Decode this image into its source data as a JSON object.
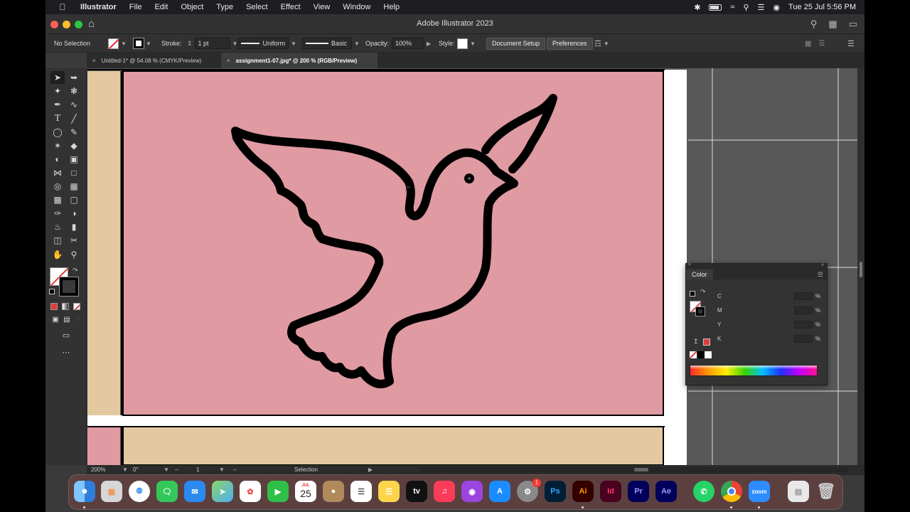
{
  "menubar": {
    "app_name": "Illustrator",
    "items": [
      "File",
      "Edit",
      "Object",
      "Type",
      "Select",
      "Effect",
      "View",
      "Window",
      "Help"
    ],
    "datetime": "Tue 25 Jul  5:56 PM"
  },
  "window": {
    "title": "Adobe Illustrator 2023"
  },
  "controlbar": {
    "selection_label": "No Selection",
    "stroke_label": "Stroke:",
    "stroke_weight": "1 pt",
    "profile_label": "Uniform",
    "brush_label": "Basic",
    "opacity_label": "Opacity:",
    "opacity_value": "100%",
    "style_label": "Style:",
    "document_setup": "Document Setup",
    "preferences": "Preferences"
  },
  "tabs": [
    {
      "label": "Untitled-1* @ 54.08 % (CMYK/Preview)"
    },
    {
      "label": "assignment1-07.jpg* @ 200 % (RGB/Preview)"
    }
  ],
  "status": {
    "zoom": "200%",
    "rotation": "0°",
    "artboard": "1",
    "tool": "Selection"
  },
  "color_panel": {
    "title": "Color",
    "channels": [
      {
        "label": "C",
        "unit": "%"
      },
      {
        "label": "M",
        "unit": "%"
      },
      {
        "label": "Y",
        "unit": "%"
      },
      {
        "label": "K",
        "unit": "%"
      }
    ]
  },
  "dock": {
    "calendar_month": "JUL",
    "calendar_day": "25",
    "apps": [
      "Finder",
      "Launchpad",
      "Safari",
      "Messages",
      "Mail",
      "Maps",
      "Photos",
      "FaceTime",
      "Calendar",
      "Contacts",
      "Reminders",
      "Notes",
      "TV",
      "Music",
      "Podcasts",
      "App Store",
      "System Settings",
      "Ps",
      "Ai",
      "Id",
      "Pr",
      "Ae",
      "WhatsApp",
      "Chrome",
      "zoom",
      "Downloads",
      "Trash"
    ],
    "tv_label": "tv",
    "settings_badge": "1"
  },
  "colors": {
    "artboard_pink": "#e09aa2",
    "artboard_tan": "#e3c8a0",
    "stroke_black": "#000000",
    "accent_red": "#e23b3b"
  }
}
